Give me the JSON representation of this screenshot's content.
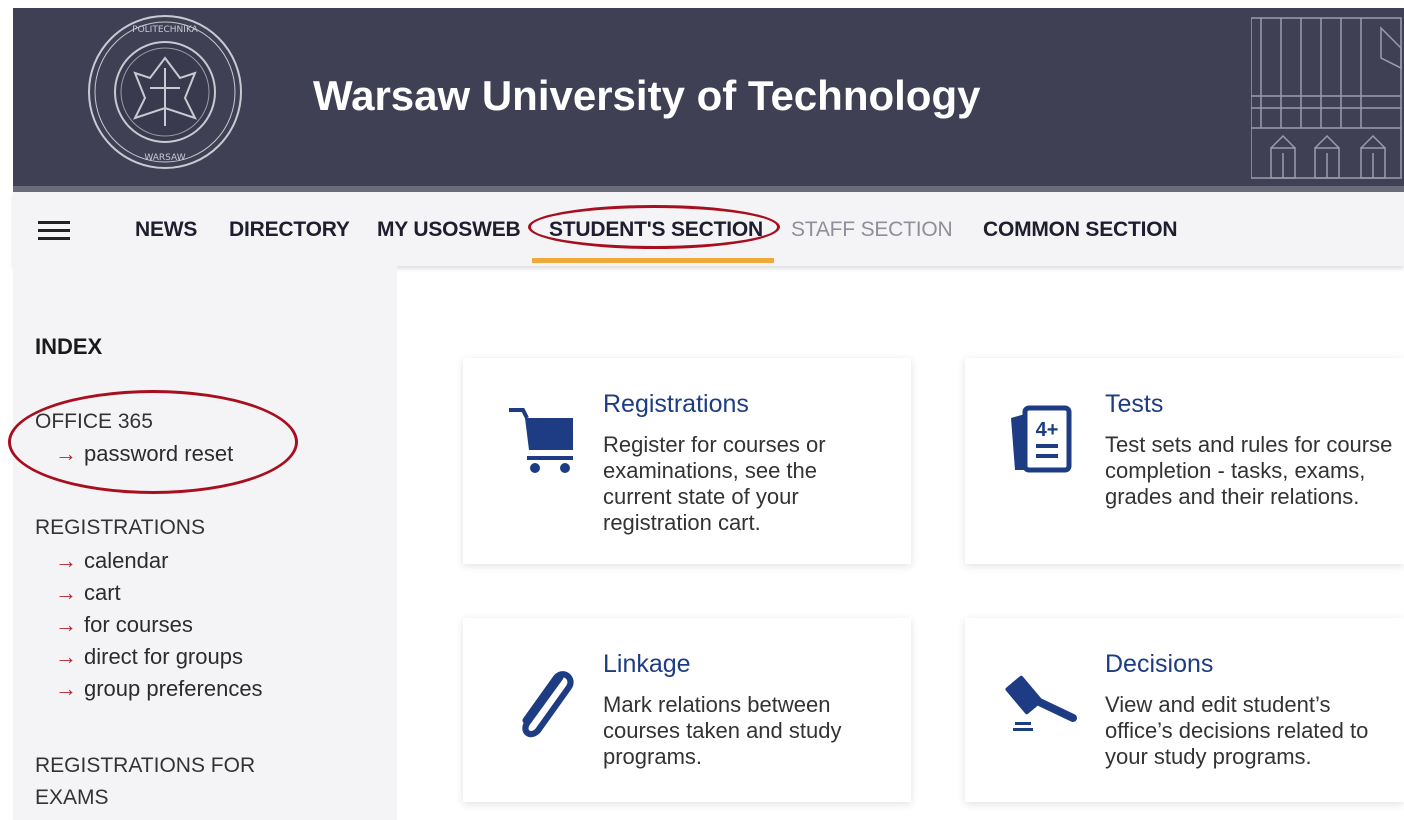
{
  "header": {
    "title": "Warsaw University of Technology",
    "seal_icon": "university-seal-icon",
    "building_icon": "building-illustration-icon"
  },
  "nav": {
    "items": [
      {
        "label": "NEWS",
        "active": false,
        "muted": false
      },
      {
        "label": "DIRECTORY",
        "active": false,
        "muted": false
      },
      {
        "label": "MY USOSWEB",
        "active": false,
        "muted": false
      },
      {
        "label": "STUDENT'S SECTION",
        "active": true,
        "muted": false
      },
      {
        "label": "STAFF SECTION",
        "active": false,
        "muted": true
      },
      {
        "label": "COMMON SECTION",
        "active": false,
        "muted": false
      }
    ],
    "accent_color": "#f0a93b"
  },
  "sidebar": {
    "title": "INDEX",
    "sections": [
      {
        "title": "OFFICE 365",
        "links": [
          "password reset"
        ]
      },
      {
        "title": "REGISTRATIONS",
        "links": [
          "calendar",
          "cart",
          "for courses",
          "direct for groups",
          "group preferences"
        ]
      },
      {
        "title": "REGISTRATIONS FOR",
        "title2": "EXAMS",
        "links": []
      }
    ],
    "arrow": "→"
  },
  "cards": [
    {
      "title": "Registrations",
      "description": "Register for courses or examinations, see the current state of your registration cart.",
      "icon": "shopping-cart-icon"
    },
    {
      "title": "Tests",
      "description": "Test sets and rules for course completion - tasks, exams, grades and their relations.",
      "icon": "test-sheet-icon"
    },
    {
      "title": "Linkage",
      "description": "Mark relations between courses taken and study programs.",
      "icon": "paperclip-icon"
    },
    {
      "title": "Decisions",
      "description": "View and edit student’s office’s decisions related to your study programs.",
      "icon": "gavel-icon"
    }
  ],
  "colors": {
    "header_bg": "#404055",
    "link_blue": "#1d3c83",
    "annotation_red": "#a80f1e"
  }
}
